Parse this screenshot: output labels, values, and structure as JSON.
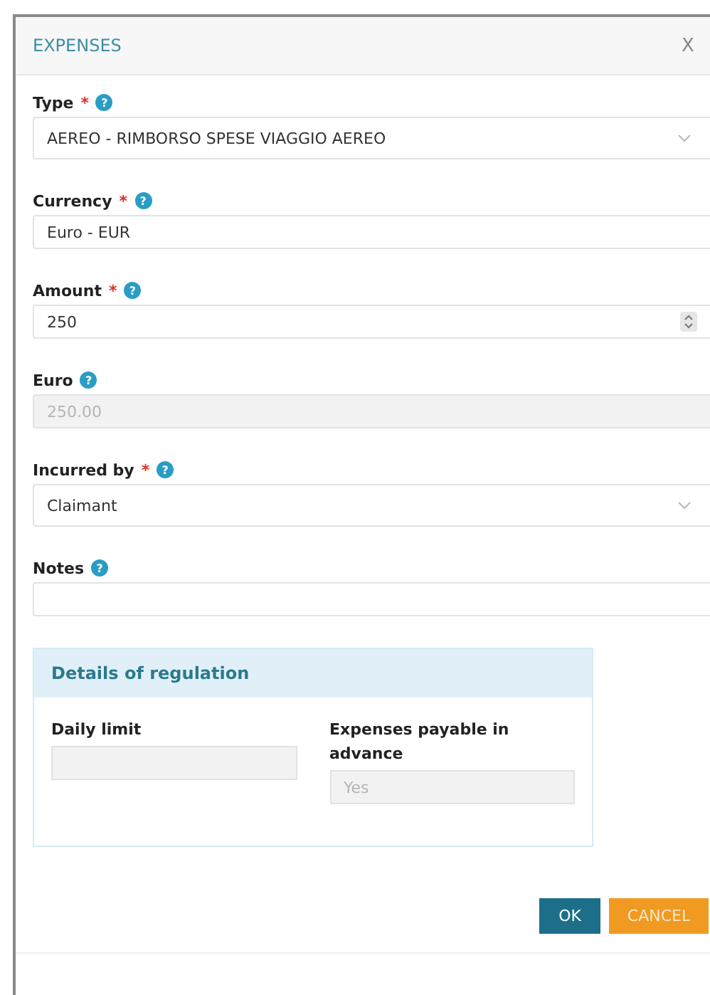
{
  "dialog": {
    "title": "EXPENSES",
    "close": "X"
  },
  "fields": [
    {
      "kind": "select",
      "label": "Type",
      "required": "*",
      "help": "?",
      "value": "AEREO - RIMBORSO SPESE VIAGGIO AEREO",
      "disabled": false
    },
    {
      "kind": "text",
      "label": "Currency",
      "required": "*",
      "help": "?",
      "value": "Euro - EUR",
      "disabled": false
    },
    {
      "kind": "number",
      "label": "Amount",
      "required": "*",
      "help": "?",
      "value": "250",
      "disabled": false
    },
    {
      "kind": "text",
      "label": "Euro",
      "help": "?",
      "value": "250.00",
      "disabled": true
    },
    {
      "kind": "select",
      "label": "Incurred by",
      "required": "*",
      "help": "?",
      "value": "Claimant",
      "disabled": false
    },
    {
      "kind": "text",
      "label": "Notes",
      "help": "?",
      "disabled": false
    }
  ],
  "regulation": {
    "title": "Details of regulation",
    "fields": [
      {
        "label": "Daily limit",
        "disabled": true
      },
      {
        "label": "Expenses payable in advance",
        "value": "Yes",
        "disabled": true
      }
    ]
  },
  "buttons": [
    {
      "kind": "primary",
      "label": "OK"
    },
    {
      "kind": "secondary",
      "label": "CANCEL"
    }
  ]
}
